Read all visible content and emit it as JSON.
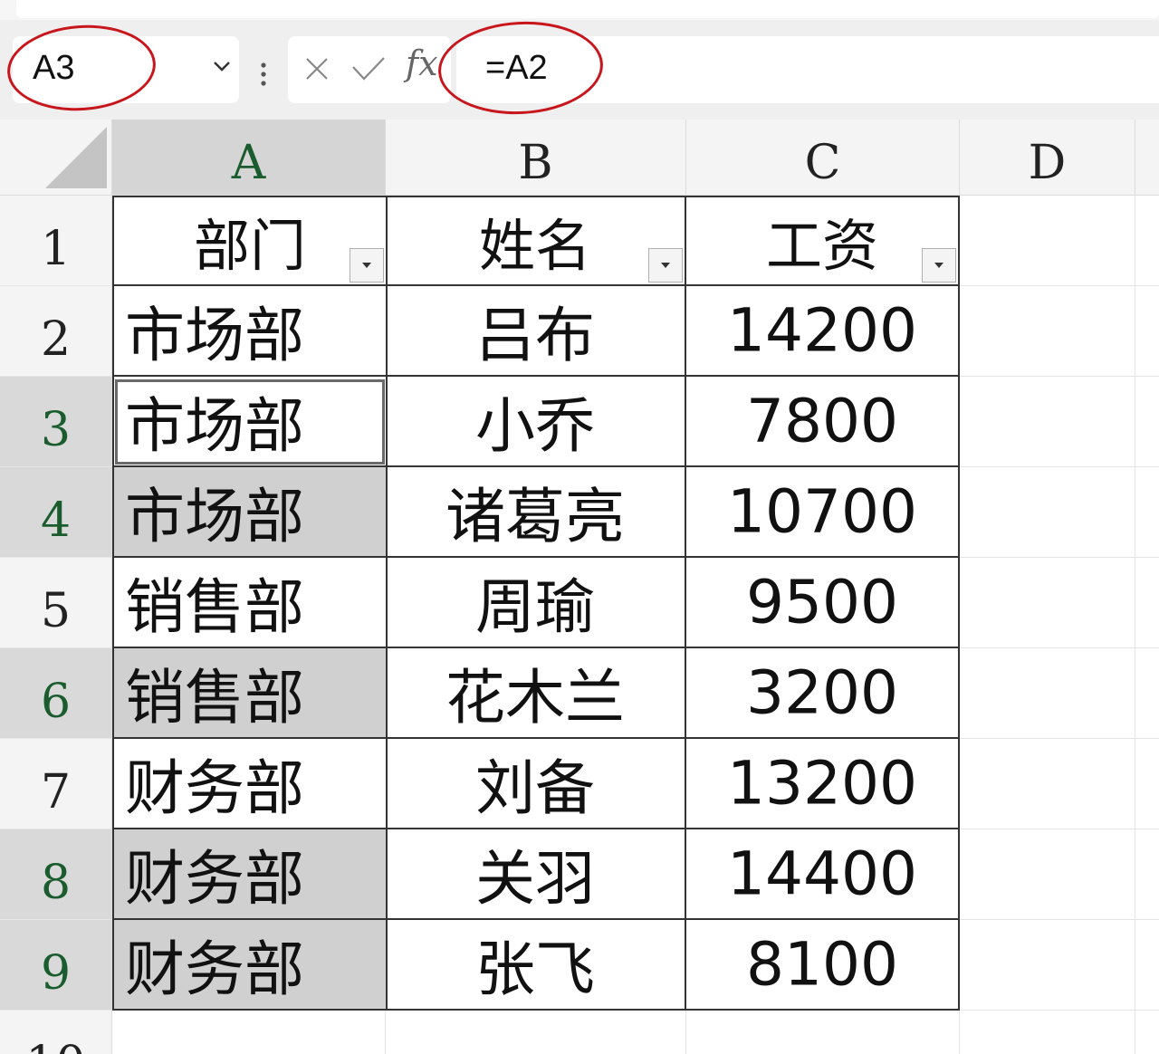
{
  "formula_bar": {
    "name_box": "A3",
    "formula": "=A2",
    "cancel_icon": "close-icon",
    "confirm_icon": "check-icon",
    "fx_label": "fx"
  },
  "sheet": {
    "columns": [
      "A",
      "B",
      "C",
      "D"
    ],
    "rows": [
      "1",
      "2",
      "3",
      "4",
      "5",
      "6",
      "7",
      "8",
      "9",
      "10"
    ],
    "headers": [
      "部门",
      "姓名",
      "工资"
    ],
    "data": [
      [
        "市场部",
        "吕布",
        "14200"
      ],
      [
        "市场部",
        "小乔",
        "7800"
      ],
      [
        "市场部",
        "诸葛亮",
        "10700"
      ],
      [
        "销售部",
        "周瑜",
        "9500"
      ],
      [
        "销售部",
        "花木兰",
        "3200"
      ],
      [
        "财务部",
        "刘备",
        "13200"
      ],
      [
        "财务部",
        "关羽",
        "14400"
      ],
      [
        "财务部",
        "张飞",
        "8100"
      ]
    ],
    "selected_cell": "A3",
    "shaded_cells": [
      "A4",
      "A6",
      "A8",
      "A9"
    ]
  },
  "colors": {
    "annotation": "#c8161d",
    "selection_fill": "#d0d0d0",
    "selected_header_text": "#1a5c2e"
  }
}
